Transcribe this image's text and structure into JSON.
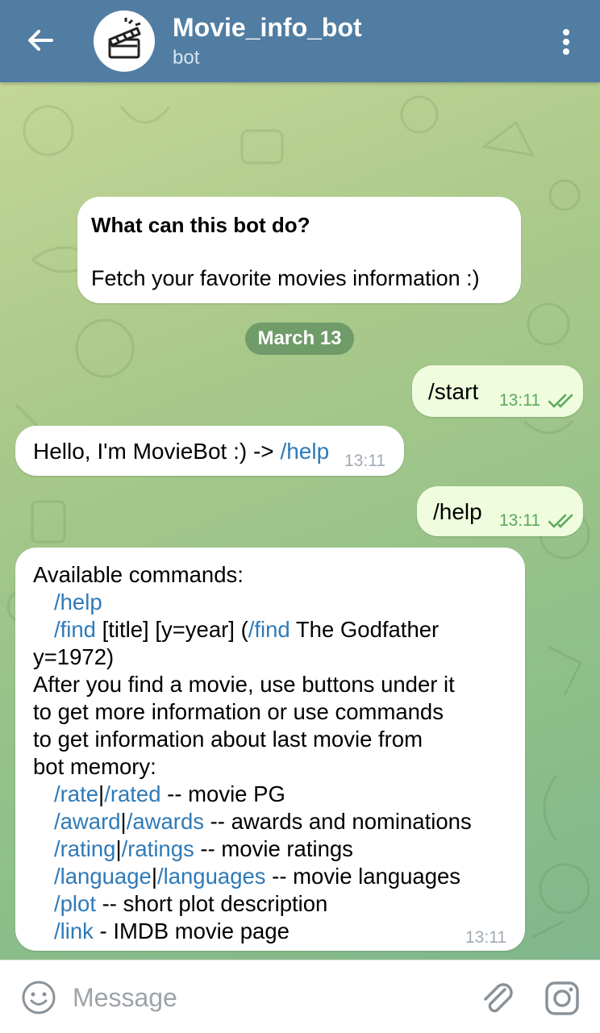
{
  "header": {
    "title": "Movie_info_bot",
    "subtitle": "bot"
  },
  "intro": {
    "heading": "What can this bot do?",
    "text": "Fetch your favorite movies information :)"
  },
  "date_badge": "March 13",
  "messages": {
    "start": {
      "cmd": "/start",
      "time": "13:11"
    },
    "hello": {
      "text": "Hello, I'm MovieBot :) -> ",
      "cmd": "/help",
      "time": "13:11"
    },
    "help": {
      "cmd": "/help",
      "time": "13:11"
    },
    "commands": {
      "time": "13:11",
      "l1": "Available commands:",
      "l2_cmd": "/help",
      "l3_cmd1": "/find",
      "l3_t1": " [title] [y=year] (",
      "l3_cmd2": "/find",
      "l3_t2": " The Godfather",
      "l4": "y=1972)",
      "l5": "After you find a movie, use buttons under it",
      "l6": "to get more information or use commands",
      "l7": "to get information about last movie from",
      "l8": "bot memory:",
      "rate_cmd1": "/rate",
      "rate_sep": "|",
      "rate_cmd2": "/rated",
      "rate_text": " -- movie PG",
      "award_cmd1": "/award",
      "award_sep": "|",
      "award_cmd2": "/awards",
      "award_text": " -- awards and nominations",
      "rating_cmd1": "/rating",
      "rating_sep": "|",
      "rating_cmd2": "/ratings",
      "rating_text": " -- movie ratings",
      "lang_cmd1": "/language",
      "lang_sep": "|",
      "lang_cmd2": "/languages",
      "lang_text": " -- movie languages",
      "plot_cmd": "/plot",
      "plot_text": " -- short plot description",
      "link_cmd": "/link",
      "link_text": " - IMDB movie page"
    }
  },
  "input": {
    "placeholder": "Message"
  },
  "icons": {
    "back": "arrow-left-icon",
    "avatar": "clapperboard-icon",
    "menu": "more-vertical-icon",
    "emoji": "smile-icon",
    "attach": "paperclip-icon",
    "camera": "camera-icon",
    "read": "double-check-icon"
  },
  "colors": {
    "header_bg": "#517da2",
    "outgoing_bubble": "#effdde",
    "incoming_bubble": "#ffffff",
    "link": "#2f7ab8",
    "date_badge": "#5c8c5c"
  }
}
